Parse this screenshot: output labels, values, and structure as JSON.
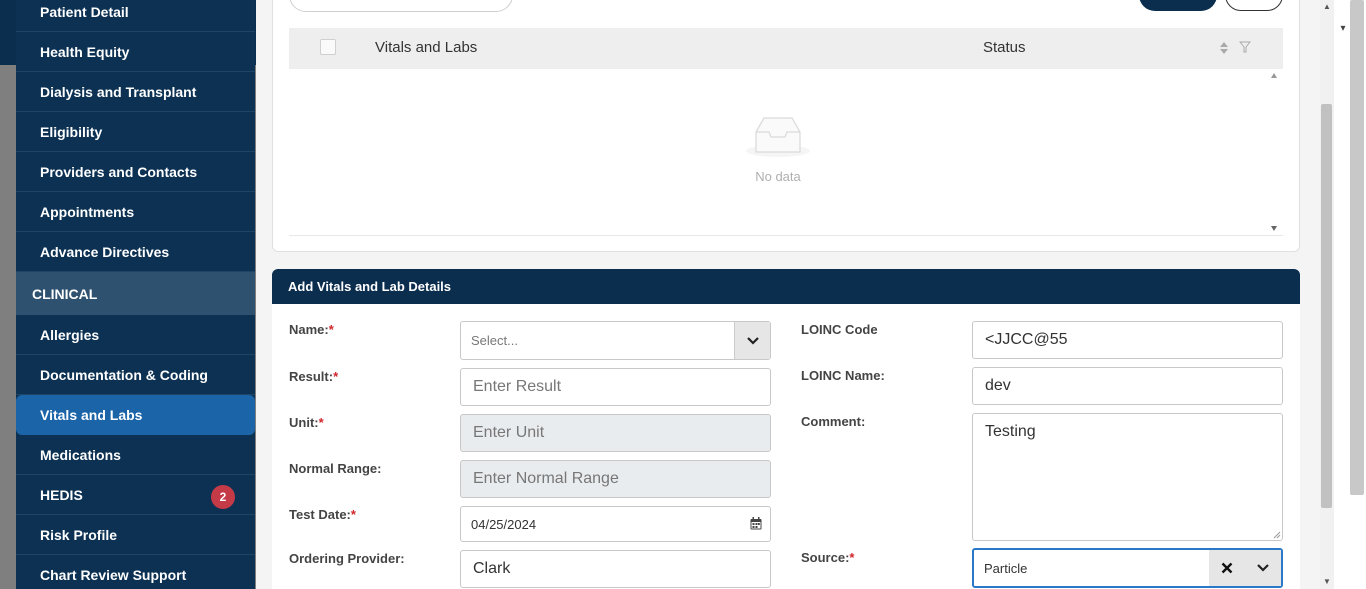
{
  "sidebar": {
    "items": [
      {
        "label": "Patient Detail"
      },
      {
        "label": "Health Equity"
      },
      {
        "label": "Dialysis and Transplant"
      },
      {
        "label": "Eligibility"
      },
      {
        "label": "Providers and Contacts"
      },
      {
        "label": "Appointments"
      },
      {
        "label": "Advance Directives"
      }
    ],
    "section": "CLINICAL",
    "clinical_items": [
      {
        "label": "Allergies"
      },
      {
        "label": "Documentation & Coding"
      },
      {
        "label": "Vitals and Labs",
        "active": true
      },
      {
        "label": "Medications"
      },
      {
        "label": "HEDIS",
        "badge": "2"
      },
      {
        "label": "Risk Profile"
      },
      {
        "label": "Chart Review Support"
      }
    ]
  },
  "table": {
    "col_vitals": "Vitals and Labs",
    "col_status": "Status",
    "empty_text": "No data"
  },
  "form": {
    "title": "Add Vitals and Lab Details",
    "name": {
      "label": "Name:",
      "placeholder": "Select..."
    },
    "result": {
      "label": "Result:",
      "placeholder": "Enter Result"
    },
    "unit": {
      "label": "Unit:",
      "placeholder": "Enter Unit"
    },
    "normal_range": {
      "label": "Normal Range:",
      "placeholder": "Enter Normal Range"
    },
    "test_date": {
      "label": "Test Date:",
      "value": "04/25/2024"
    },
    "ordering_provider": {
      "label": "Ordering Provider:",
      "value": "Clark"
    },
    "loinc_code": {
      "label": "LOINC Code",
      "value": "<JJCC@55"
    },
    "loinc_name": {
      "label": "LOINC Name:",
      "value": "dev"
    },
    "comment": {
      "label": "Comment:",
      "value": "Testing"
    },
    "source": {
      "label": "Source:",
      "value": "Particle"
    },
    "required_mark": "*"
  },
  "colors": {
    "navy": "#0b2e4e",
    "active_nav": "#1c64a8",
    "badge": "#c53a47",
    "required": "#d0262b"
  }
}
